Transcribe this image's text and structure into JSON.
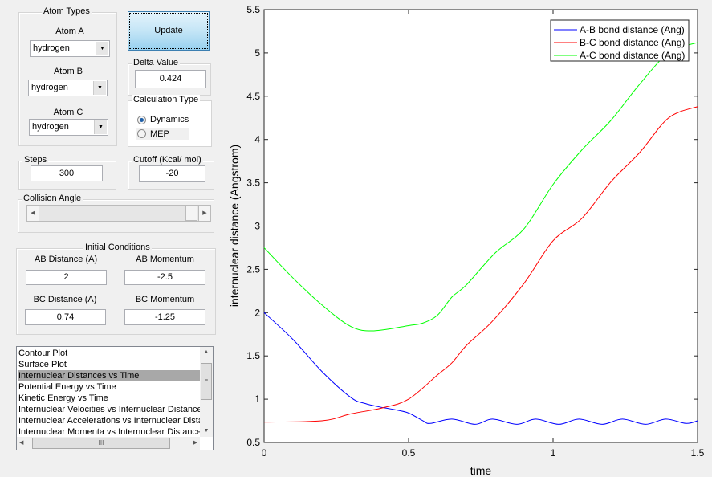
{
  "atom_types": {
    "title": "Atom Types",
    "atom_a": {
      "label": "Atom A",
      "value": "hydrogen"
    },
    "atom_b": {
      "label": "Atom B",
      "value": "hydrogen"
    },
    "atom_c": {
      "label": "Atom C",
      "value": "hydrogen"
    }
  },
  "update_label": "Update",
  "delta": {
    "title": "Delta Value",
    "value": "0.424"
  },
  "calc_type": {
    "title": "Calculation Type",
    "options": [
      "Dynamics",
      "MEP"
    ],
    "selected": "Dynamics"
  },
  "steps": {
    "title": "Steps",
    "value": "300"
  },
  "cutoff": {
    "title": "Cutoff (Kcal/ mol)",
    "value": "-20"
  },
  "collision": {
    "title": "Collision Angle",
    "slider_fraction": 1.0
  },
  "initial": {
    "title": "Initial Conditions",
    "ab_dist": {
      "label": "AB Distance (A)",
      "value": "2"
    },
    "ab_mom": {
      "label": "AB Momentum",
      "value": "-2.5"
    },
    "bc_dist": {
      "label": "BC Distance (A)",
      "value": "0.74"
    },
    "bc_mom": {
      "label": "BC Momentum",
      "value": "-1.25"
    }
  },
  "plot_list": {
    "items": [
      "Contour Plot",
      "Surface Plot",
      "Internuclear Distances vs Time",
      "Potential Energy vs Time",
      "Kinetic Energy vs Time",
      "Internuclear Velocities vs Internuclear Distance",
      "Internuclear Accelerations vs Internuclear Distance",
      "Internuclear Momenta vs Internuclear Distance"
    ],
    "selected_index": 2,
    "hscroll_glyph": "III"
  },
  "chart_data": {
    "type": "line",
    "xlabel": "time",
    "ylabel": "internuclear distance (Angstrom)",
    "xlim": [
      0,
      1.5
    ],
    "ylim": [
      0.5,
      5.5
    ],
    "xticks": [
      "0",
      "0.5",
      "1",
      "1.5"
    ],
    "yticks": [
      "0.5",
      "1",
      "1.5",
      "2",
      "2.5",
      "3",
      "3.5",
      "4",
      "4.5",
      "5",
      "5.5"
    ],
    "grid": false,
    "legend": "top-right",
    "series": [
      {
        "name": "A-B bond distance (Ang)",
        "color": "#0000ff",
        "points": [
          [
            0,
            2.0
          ],
          [
            0.1,
            1.69
          ],
          [
            0.2,
            1.32
          ],
          [
            0.3,
            1.02
          ],
          [
            0.35,
            0.95
          ],
          [
            0.4,
            0.91
          ],
          [
            0.45,
            0.88
          ],
          [
            0.5,
            0.84
          ],
          [
            0.55,
            0.75
          ],
          [
            0.575,
            0.72
          ],
          [
            0.65,
            0.77
          ],
          [
            0.73,
            0.71
          ],
          [
            0.79,
            0.77
          ],
          [
            0.875,
            0.71
          ],
          [
            0.94,
            0.77
          ],
          [
            1.02,
            0.71
          ],
          [
            1.09,
            0.77
          ],
          [
            1.17,
            0.71
          ],
          [
            1.24,
            0.77
          ],
          [
            1.32,
            0.71
          ],
          [
            1.39,
            0.77
          ],
          [
            1.46,
            0.72
          ],
          [
            1.5,
            0.75
          ]
        ]
      },
      {
        "name": "B-C bond distance (Ang)",
        "color": "#ff0000",
        "points": [
          [
            0,
            0.735
          ],
          [
            0.2,
            0.75
          ],
          [
            0.3,
            0.83
          ],
          [
            0.41,
            0.9
          ],
          [
            0.5,
            1.0
          ],
          [
            0.6,
            1.28
          ],
          [
            0.65,
            1.42
          ],
          [
            0.7,
            1.62
          ],
          [
            0.79,
            1.9
          ],
          [
            0.9,
            2.34
          ],
          [
            1.0,
            2.83
          ],
          [
            1.1,
            3.09
          ],
          [
            1.2,
            3.51
          ],
          [
            1.3,
            3.85
          ],
          [
            1.4,
            4.25
          ],
          [
            1.5,
            4.38
          ]
        ]
      },
      {
        "name": "A-C bond distance (Ang)",
        "color": "#00ff00",
        "points": [
          [
            0,
            2.75
          ],
          [
            0.1,
            2.4
          ],
          [
            0.2,
            2.09
          ],
          [
            0.3,
            1.84
          ],
          [
            0.38,
            1.79
          ],
          [
            0.5,
            1.85
          ],
          [
            0.55,
            1.88
          ],
          [
            0.6,
            1.97
          ],
          [
            0.65,
            2.18
          ],
          [
            0.7,
            2.32
          ],
          [
            0.8,
            2.69
          ],
          [
            0.9,
            2.97
          ],
          [
            1.0,
            3.48
          ],
          [
            1.1,
            3.88
          ],
          [
            1.2,
            4.22
          ],
          [
            1.3,
            4.64
          ],
          [
            1.4,
            5.0
          ],
          [
            1.5,
            5.12
          ]
        ]
      }
    ]
  }
}
